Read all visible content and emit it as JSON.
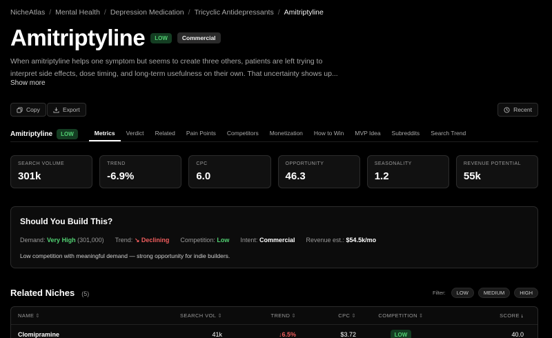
{
  "breadcrumb": [
    "NicheAtlas",
    "Mental Health",
    "Depression Medication",
    "Tricyclic Antidepressants",
    "Amitriptyline"
  ],
  "page": {
    "title": "Amitriptyline",
    "competition_badge": "LOW",
    "intent_badge": "Commercial",
    "description": "When amitriptyline helps one symptom but seems to create three others, patients are left trying to interpret side effects, dose timing, and long-term usefulness on their own. That uncertainty shows up...",
    "show_more": "Show more"
  },
  "actions": {
    "copy": "Copy",
    "export": "Export",
    "recent": "Recent"
  },
  "tabbar": {
    "niche": "Amitriptyline",
    "badge": "LOW",
    "tabs": [
      "Metrics",
      "Verdict",
      "Related",
      "Pain Points",
      "Competitors",
      "Monetization",
      "How to Win",
      "MVP Idea",
      "Subreddits",
      "Search Trend"
    ],
    "active": "Metrics"
  },
  "metrics": [
    {
      "label": "SEARCH VOLUME",
      "value": "301k"
    },
    {
      "label": "TREND",
      "value": "-6.9%"
    },
    {
      "label": "CPC",
      "value": "6.0"
    },
    {
      "label": "OPPORTUNITY",
      "value": "46.3"
    },
    {
      "label": "SEASONALITY",
      "value": "1.2"
    },
    {
      "label": "REVENUE POTENTIAL",
      "value": "55k"
    }
  ],
  "build": {
    "title": "Should You Build This?",
    "demand_label": "Demand:",
    "demand_value": "Very High",
    "demand_detail": "(301,000)",
    "trend_label": "Trend:",
    "trend_value": "↘ Declining",
    "competition_label": "Competition:",
    "competition_value": "Low",
    "intent_label": "Intent:",
    "intent_value": "Commercial",
    "revenue_label": "Revenue est.:",
    "revenue_value": "$54.5k/mo",
    "note": "Low competition with meaningful demand — strong opportunity for indie builders."
  },
  "related": {
    "title": "Related Niches",
    "count": "(5)",
    "filter_label": "Filter:",
    "filters": [
      "LOW",
      "MEDIUM",
      "HIGH"
    ],
    "columns": {
      "name": "NAME",
      "vol": "SEARCH VOL",
      "trend": "TREND",
      "cpc": "CPC",
      "competition": "COMPETITION",
      "score": "SCORE"
    },
    "rows": [
      {
        "name": "Clomipramine",
        "vol": "41k",
        "trend": "↓6.5%",
        "cpc": "$3.72",
        "competition": "LOW",
        "score": "40.0"
      }
    ]
  },
  "colors": {
    "accent_green": "#52d273",
    "negative_red": "#ef5d5d",
    "background": "#000000"
  }
}
